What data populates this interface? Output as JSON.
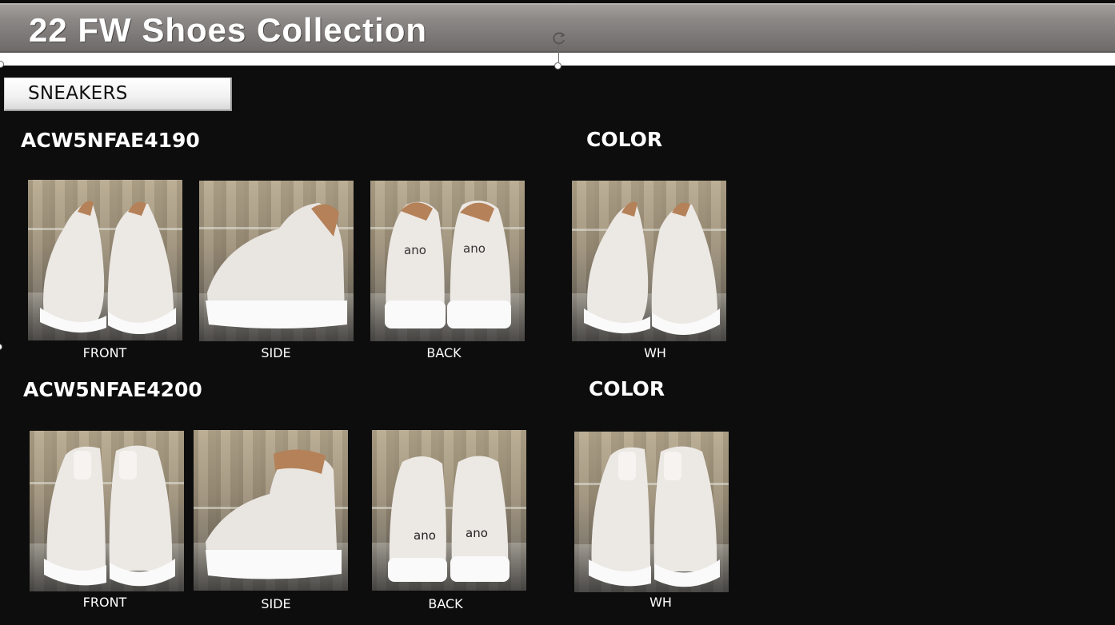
{
  "header": {
    "title": "22 FW Shoes Collection"
  },
  "category": {
    "label": "SNEAKERS"
  },
  "products": [
    {
      "code": "ACW5NFAE4190",
      "color_heading": "COLOR",
      "views": [
        "FRONT",
        "SIDE",
        "BACK"
      ],
      "color_option": "WH",
      "brand_mark": "ano"
    },
    {
      "code": "ACW5NFAE4200",
      "color_heading": "COLOR",
      "views": [
        "FRONT",
        "SIDE",
        "BACK"
      ],
      "color_option": "WH",
      "brand_mark": "ano"
    }
  ],
  "colors": {
    "background": "#0d0d0d",
    "banner": "#7b7776",
    "shoe": "#ece8e4",
    "heel_accent": "#b58158"
  }
}
